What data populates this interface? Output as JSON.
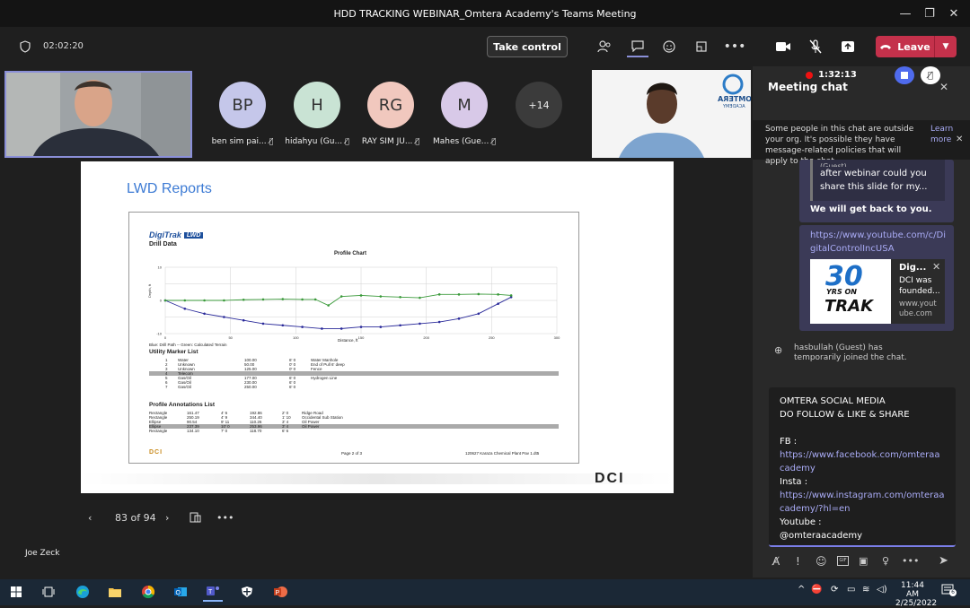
{
  "window": {
    "title": "HDD TRACKING WEBINAR_Omtera Academy's Teams Meeting",
    "minimize_glyph": "—",
    "restore_glyph": "❐",
    "close_glyph": "✕"
  },
  "toolbar": {
    "timer": "02:02:20",
    "take_control_label": "Take control",
    "leave_label": "Leave",
    "leave_color": "#c4314b"
  },
  "self_view": {
    "name": "Joe Zeck"
  },
  "participants": [
    {
      "initials": "BP",
      "name": "ben sim pai...",
      "color": "#c5c7ea"
    },
    {
      "initials": "H",
      "name": "hidahyu (Gu...",
      "color": "#c9e3d4"
    },
    {
      "initials": "RG",
      "name": "RAY SIM JU...",
      "color": "#f1c8be"
    },
    {
      "initials": "M",
      "name": "Mahes (Gue...",
      "color": "#d8c9e8"
    },
    {
      "initials": "+14",
      "name": "",
      "color": "#3b3b3b"
    }
  ],
  "remote_video": {
    "logo_text": "OMTERA",
    "logo_sub": "ACADEMY"
  },
  "slide": {
    "title": "LWD Reports",
    "page_indicator": "83 of 94",
    "brand_mark": "DCI",
    "doc": {
      "brand": "DigiTrak",
      "brand_badge": "LWD",
      "subtitle": "Drill Data",
      "chart_title": "Profile Chart",
      "legend_note": "Blue: Drill Path -- Green: Calculated Terrain",
      "x_axis_label": "Distance, ft",
      "y_axis_label": "Depth, ft",
      "utility_title": "Utility Marker List",
      "annotations_title": "Profile Annotations List",
      "footer_left": "DCI",
      "footer_center": "Page 2 of 3",
      "footer_right": "120627 Karaza Chemical Plant Pav 1.dt5"
    }
  },
  "chart_data": {
    "type": "line",
    "title": "Profile Chart",
    "xlabel": "Distance, ft",
    "ylabel": "Depth, ft",
    "xlim": [
      0,
      300
    ],
    "ylim": [
      -10,
      10
    ],
    "x_ticks": [
      0,
      50,
      100,
      150,
      200,
      250,
      300
    ],
    "y_ticks": [
      10,
      5,
      0,
      -5,
      -10
    ],
    "series": [
      {
        "name": "Drill Path",
        "color": "#2a2a9a",
        "x": [
          0,
          15,
          30,
          45,
          60,
          75,
          90,
          105,
          120,
          135,
          150,
          165,
          180,
          195,
          210,
          225,
          240,
          255,
          265
        ],
        "y": [
          0,
          -2.5,
          -4,
          -5,
          -6,
          -7,
          -7.5,
          -8,
          -8.5,
          -8.5,
          -8,
          -8,
          -7.5,
          -7,
          -6.5,
          -5.5,
          -4,
          -1,
          1
        ]
      },
      {
        "name": "Calculated Terrain",
        "color": "#3a9a3a",
        "x": [
          0,
          15,
          30,
          45,
          60,
          75,
          90,
          105,
          115,
          125,
          135,
          150,
          165,
          180,
          195,
          210,
          225,
          240,
          255,
          265
        ],
        "y": [
          0,
          0,
          0,
          0,
          0.2,
          0.3,
          0.4,
          0.3,
          0.3,
          -1.5,
          1.2,
          1.5,
          1.2,
          1.0,
          0.8,
          1.8,
          1.8,
          1.9,
          1.8,
          1.5
        ]
      }
    ],
    "annotations": [
      "Oil Power",
      "Oil Power",
      "Ridge Road",
      "Occidental Sub Station",
      "Water Manhole",
      "End of Pull 6' deep",
      "Fence",
      "Telecom",
      "Hydrogen Line",
      "Gas/Oil",
      "Gas/Oil"
    ]
  },
  "utility_rows": [
    [
      "1",
      "Water",
      "100.00",
      "6' 0",
      "Water Manhole"
    ],
    [
      "2",
      "Unknown",
      "50.00",
      "0' 0",
      "End of Pull 6' deep"
    ],
    [
      "3",
      "Unknown",
      "125.00",
      "0' 0",
      "Fence"
    ],
    [
      "4",
      "Telecom",
      "",
      "",
      ""
    ],
    [
      "5",
      "Gas/Oil",
      "177.00",
      "6' 0",
      "Hydrogen Line"
    ],
    [
      "6",
      "Gas/Oil",
      "230.00",
      "6' 0",
      ""
    ],
    [
      "7",
      "Gas/Oil",
      "250.00",
      "6' 0",
      ""
    ]
  ],
  "annotation_rows": [
    [
      "Rectangle",
      "161.47",
      "4' 6",
      "192.86",
      "2' 0",
      "Ridge Road"
    ],
    [
      "Rectangle",
      "250.19",
      "4' 9",
      "344.40",
      "1' 10",
      "Occidental Sub Station"
    ],
    [
      "Ellipse",
      "90.54",
      "9' 11",
      "110.26",
      "3' 4",
      "Oil Power"
    ],
    [
      "Ellipse",
      "237.39",
      "10' 0",
      "253.96",
      "3' 4",
      "Oil Power"
    ],
    [
      "Rectangle",
      "134.10",
      "7' 0",
      "118.70",
      "6' 6",
      ""
    ]
  ],
  "chat": {
    "title": "Meeting chat",
    "recording_time": "1:32:13",
    "notice": "Some people in this chat are outside your org. It's possible they have message-related policies that will apply to the chat.",
    "learn_more": "Learn more",
    "quoted_snippet": "(Guest)",
    "quoted_text": "after webinar could you share this slide for my...",
    "reply": "We will get back to you.",
    "link": "https://www.youtube.com/c/DigitalControlIncUSA",
    "card_title": "Dig...",
    "card_desc": "DCI was founded...",
    "card_domain": "www.youtube.com",
    "card_thumb_num": "30",
    "card_thumb_sub": "YRS ON",
    "card_thumb_brand": "TRAK",
    "system_msg": "hasbullah (Guest) has temporarily joined the chat.",
    "compose": {
      "line1": "OMTERA SOCIAL MEDIA",
      "line2": "DO FOLLOW & LIKE & SHARE",
      "fb_label": "FB :",
      "fb_link": "https://www.facebook.com/omteraacademy",
      "insta_label": "Insta :",
      "insta_link": "https://www.instagram.com/omteraacademy/?hl=en",
      "yt_label": "Youtube :",
      "yt_handle": "@omteraacademy"
    }
  },
  "taskbar": {
    "time": "11:44 AM",
    "date": "2/25/2022",
    "notif_count": "6"
  }
}
